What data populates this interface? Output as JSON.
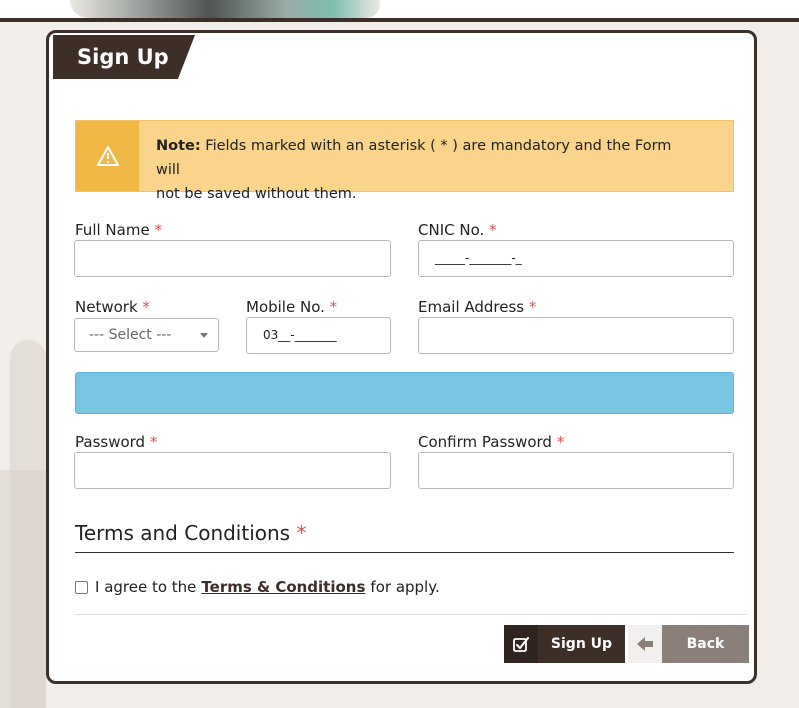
{
  "form": {
    "title": "Sign Up",
    "note_bold": "Note:",
    "note_line1": "Fields marked with an asterisk ( * ) are mandatory and the Form will",
    "note_line2": "not be saved without them."
  },
  "fields": {
    "full_name": {
      "label": "Full Name",
      "value": ""
    },
    "cnic": {
      "label": "CNIC No.",
      "value": "_____-_______-_"
    },
    "network": {
      "label": "Network",
      "selected": "--- Select ---"
    },
    "mobile": {
      "label": "Mobile No.",
      "value": "03__-_______"
    },
    "email": {
      "label": "Email Address",
      "value": ""
    },
    "password": {
      "label": "Password",
      "value": ""
    },
    "confirm_password": {
      "label": "Confirm Password",
      "value": ""
    }
  },
  "required_mark": "*",
  "terms": {
    "heading": "Terms and Conditions",
    "agree_prefix": "I agree to the",
    "link_text": "Terms & Conditions",
    "agree_suffix": "for apply."
  },
  "buttons": {
    "signup_label": "Sign Up",
    "back_label": "Back"
  },
  "icons": {
    "note": "warning-icon",
    "signup": "checkbox-check-icon",
    "back": "arrow-left-icon"
  },
  "colors": {
    "brand_dark": "#3d2f28",
    "note_bg": "#f9d48a",
    "note_icon_bg": "#f2b846",
    "info_bar": "#77c5e2",
    "back_button": "#8a7f79",
    "required": "#d9534f"
  }
}
